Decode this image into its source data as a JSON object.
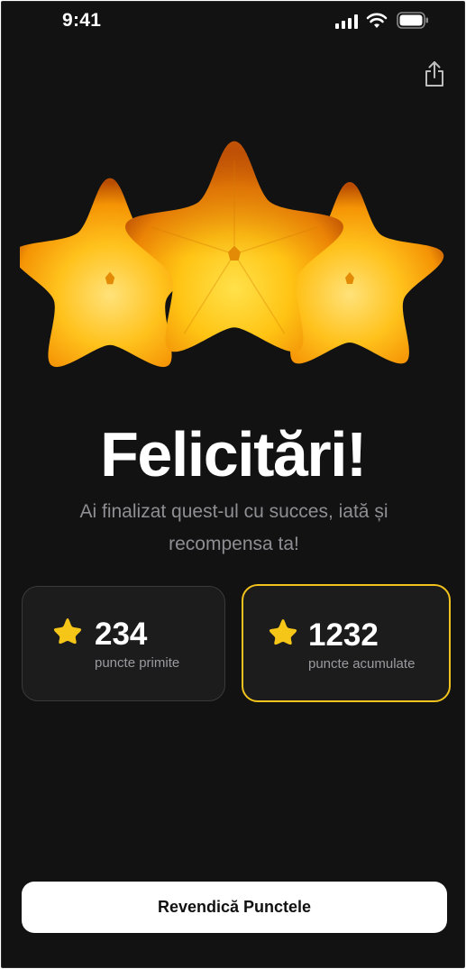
{
  "status_bar": {
    "time": "9:41"
  },
  "header": {
    "share_icon": "share-icon"
  },
  "hero": {
    "title": "Felicitări!",
    "subtitle": "Ai finalizat quest-ul cu succes, iată și recompensa ta!"
  },
  "cards": [
    {
      "value": "234",
      "label": "puncte primite",
      "icon": "star-icon"
    },
    {
      "value": "1232",
      "label": "puncte acumulate",
      "icon": "star-icon"
    }
  ],
  "cta": {
    "label": "Revendică Punctele"
  },
  "colors": {
    "background": "#121212",
    "accent": "#f2c21d",
    "text_primary": "#ffffff",
    "text_secondary": "#8e8e93"
  }
}
